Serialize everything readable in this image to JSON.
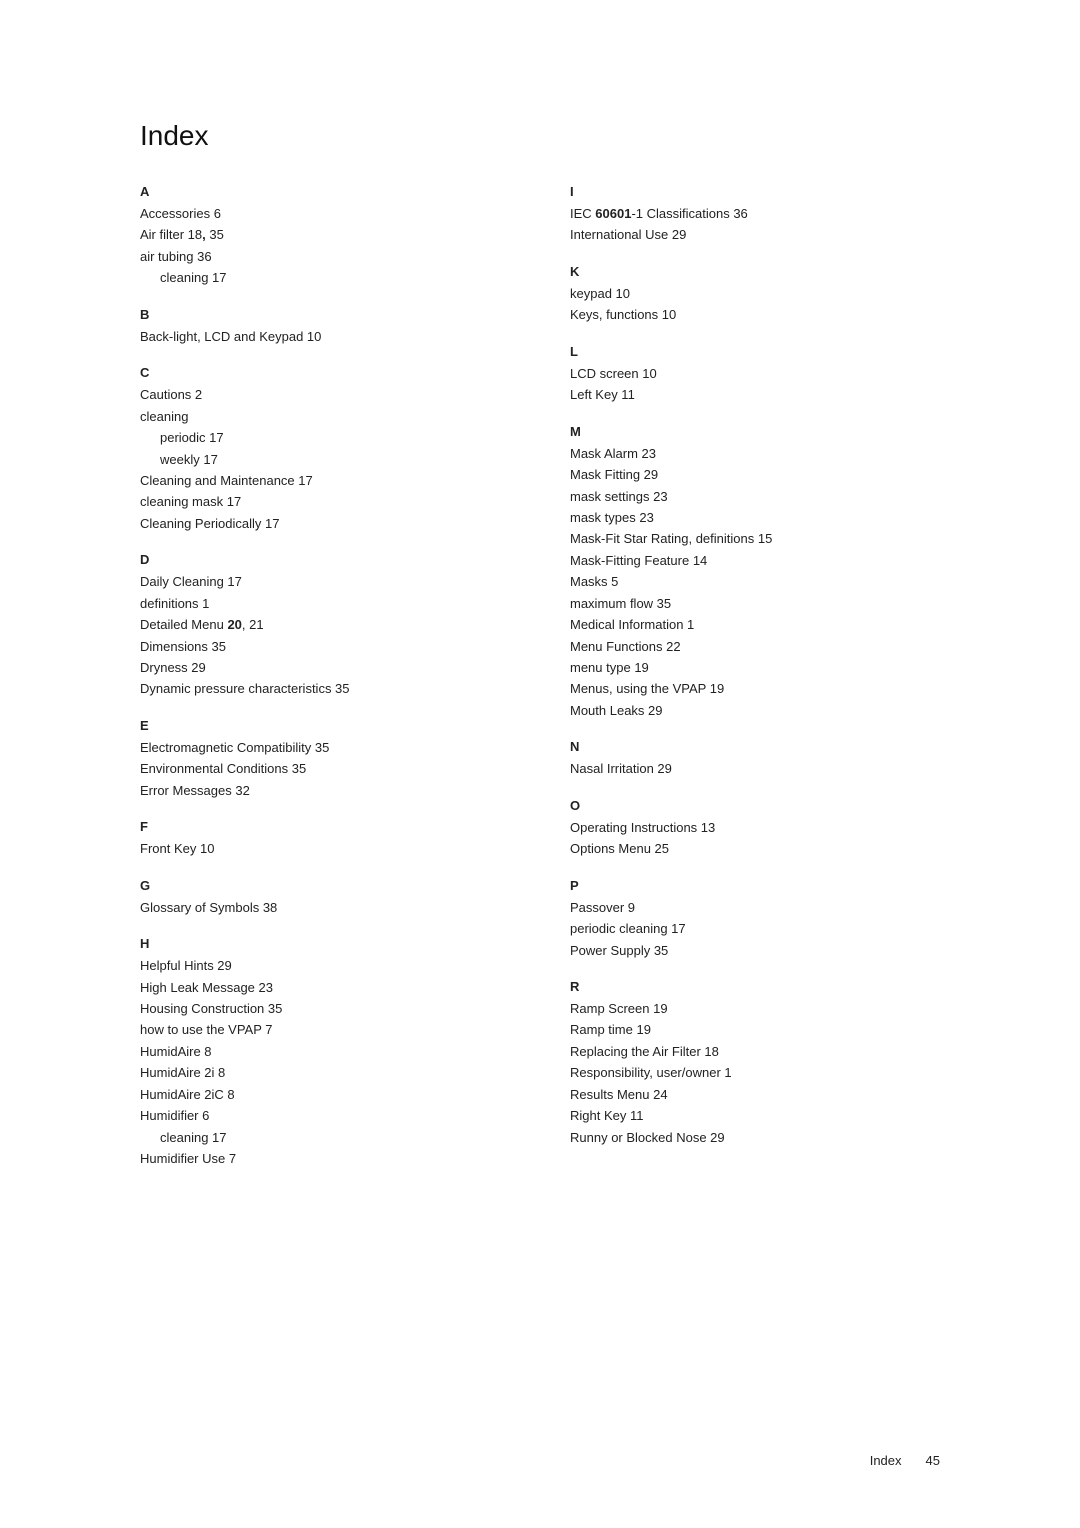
{
  "page": {
    "title": "Index",
    "footer_label": "Index",
    "footer_page": "45"
  },
  "left_column": [
    {
      "letter": "A",
      "items": [
        {
          "text": "Accessories 6"
        },
        {
          "text": "Air filter 18, 35",
          "bold_parts": [
            "18"
          ]
        },
        {
          "text": "air tubing 36"
        },
        {
          "text": "cleaning 17",
          "indent": true
        }
      ]
    },
    {
      "letter": "B",
      "items": [
        {
          "text": "Back-light, LCD and Keypad 10"
        }
      ]
    },
    {
      "letter": "C",
      "items": [
        {
          "text": "Cautions 2"
        },
        {
          "text": "cleaning"
        },
        {
          "text": "periodic 17",
          "indent": true
        },
        {
          "text": "weekly 17",
          "indent": true
        },
        {
          "text": "Cleaning and Maintenance 17"
        },
        {
          "text": "cleaning mask 17"
        },
        {
          "text": "Cleaning Periodically 17"
        }
      ]
    },
    {
      "letter": "D",
      "items": [
        {
          "text": "Daily Cleaning 17"
        },
        {
          "text": "definitions 1"
        },
        {
          "text": "Detailed Menu 20, 21",
          "bold_parts": [
            "20"
          ]
        },
        {
          "text": "Dimensions 35"
        },
        {
          "text": "Dryness 29"
        },
        {
          "text": "Dynamic pressure characteristics 35"
        }
      ]
    },
    {
      "letter": "E",
      "items": [
        {
          "text": "Electromagnetic Compatibility 35"
        },
        {
          "text": "Environmental Conditions 35"
        },
        {
          "text": "Error Messages 32"
        }
      ]
    },
    {
      "letter": "F",
      "items": [
        {
          "text": "Front Key 10"
        }
      ]
    },
    {
      "letter": "G",
      "items": [
        {
          "text": "Glossary of Symbols 38"
        }
      ]
    },
    {
      "letter": "H",
      "items": [
        {
          "text": "Helpful Hints 29"
        },
        {
          "text": "High Leak Message 23"
        },
        {
          "text": "Housing Construction 35"
        },
        {
          "text": "how to use the VPAP 7"
        },
        {
          "text": "HumidAire 8"
        },
        {
          "text": "HumidAire 2i 8"
        },
        {
          "text": "HumidAire 2iC 8"
        },
        {
          "text": "Humidifier 6"
        },
        {
          "text": "cleaning 17",
          "indent": true
        },
        {
          "text": "Humidifier Use 7"
        }
      ]
    }
  ],
  "right_column": [
    {
      "letter": "I",
      "items": [
        {
          "text": "IEC 60601-1 Classifications 36",
          "bold_parts": [
            "60601"
          ]
        },
        {
          "text": "International Use 29"
        }
      ]
    },
    {
      "letter": "K",
      "items": [
        {
          "text": "keypad 10"
        },
        {
          "text": "Keys, functions 10"
        }
      ]
    },
    {
      "letter": "L",
      "items": [
        {
          "text": "LCD screen 10"
        },
        {
          "text": "Left Key 11"
        }
      ]
    },
    {
      "letter": "M",
      "items": [
        {
          "text": "Mask Alarm 23"
        },
        {
          "text": "Mask Fitting 29"
        },
        {
          "text": "mask settings 23"
        },
        {
          "text": "mask types 23"
        },
        {
          "text": "Mask-Fit Star Rating, definitions 15"
        },
        {
          "text": "Mask-Fitting Feature 14"
        },
        {
          "text": "Masks 5"
        },
        {
          "text": "maximum flow 35"
        },
        {
          "text": "Medical Information 1"
        },
        {
          "text": "Menu Functions 22"
        },
        {
          "text": "menu type 19"
        },
        {
          "text": "Menus, using the VPAP 19"
        },
        {
          "text": "Mouth Leaks 29"
        }
      ]
    },
    {
      "letter": "N",
      "items": [
        {
          "text": "Nasal Irritation 29"
        }
      ]
    },
    {
      "letter": "O",
      "items": [
        {
          "text": "Operating Instructions 13"
        },
        {
          "text": "Options Menu 25"
        }
      ]
    },
    {
      "letter": "P",
      "items": [
        {
          "text": "Passover 9"
        },
        {
          "text": "periodic cleaning 17"
        },
        {
          "text": "Power Supply 35"
        }
      ]
    },
    {
      "letter": "R",
      "items": [
        {
          "text": "Ramp Screen 19"
        },
        {
          "text": "Ramp time 19"
        },
        {
          "text": "Replacing the Air Filter 18"
        },
        {
          "text": "Responsibility, user/owner 1"
        },
        {
          "text": "Results Menu 24"
        },
        {
          "text": "Right Key 11"
        },
        {
          "text": "Runny or Blocked Nose 29"
        }
      ]
    }
  ]
}
